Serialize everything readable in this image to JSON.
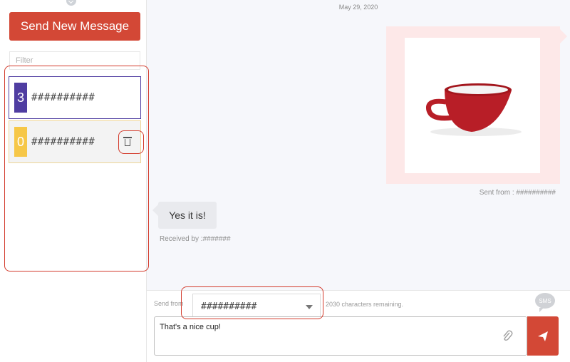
{
  "sidebar": {
    "send_new_message": "Send New Message",
    "filter_placeholder": "Filter",
    "contacts": [
      {
        "badge": "3",
        "name": "##########",
        "badge_color": "#4f3da1"
      },
      {
        "badge": "0",
        "name": "##########",
        "badge_color": "#f6c748"
      }
    ]
  },
  "chat": {
    "date": "May 29, 2020",
    "sent": {
      "image_alt": "red cup",
      "meta": "Sent from : ##########"
    },
    "received": {
      "text": "Yes it is!",
      "meta": "Received by :#######"
    }
  },
  "composer": {
    "send_from_label": "Send from",
    "selected_number": "##########",
    "chars_remaining": "2030 characters remaining.",
    "sms_icon_label": "SMS",
    "message_value": "That's a nice cup!"
  },
  "colors": {
    "accent": "#d34836",
    "selected_border": "#4f3da1",
    "highlight": "#d33b2c"
  },
  "icons": {
    "top": "arrow-circle-down-icon",
    "trash": "trash-icon",
    "attach": "paperclip-icon",
    "send": "paper-plane-icon",
    "sms": "sms-bubble-icon"
  }
}
